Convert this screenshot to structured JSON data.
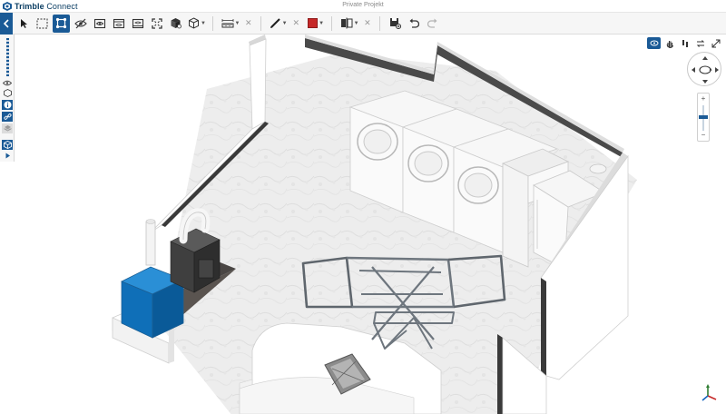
{
  "app": {
    "brand_name": "Trimble",
    "brand_product": "Connect",
    "project_title": "Private Projekt"
  },
  "colors": {
    "accent": "#1a5a96",
    "markup_color": "#c62828"
  },
  "toolbar": {
    "items": [
      {
        "icon": "back-arrow-icon"
      },
      {
        "icon": "select-pointer-icon"
      },
      {
        "icon": "box-select-icon"
      },
      {
        "icon": "node-select-icon",
        "active": true
      },
      {
        "icon": "hide-icon"
      },
      {
        "icon": "isolate-icon"
      },
      {
        "icon": "section-box-icon"
      },
      {
        "icon": "section-plane-icon"
      },
      {
        "icon": "fit-view-icon"
      },
      {
        "icon": "object-properties-icon"
      },
      {
        "icon": "view-cube-icon"
      },
      {
        "icon": "measure-icon"
      },
      {
        "icon": "markup-pen-icon"
      },
      {
        "icon": "color-picker-icon"
      },
      {
        "icon": "clip-plane-icon"
      },
      {
        "icon": "save-view-icon"
      },
      {
        "icon": "undo-icon"
      },
      {
        "icon": "redo-icon"
      }
    ]
  },
  "leftbar": {
    "items": [
      "eye-icon",
      "cube-outline-icon",
      "info-icon",
      "link-icon",
      "layers-icon",
      "model-icon",
      "play-icon"
    ]
  },
  "navigation": {
    "modes": [
      "orbit-icon",
      "pan-icon",
      "walk-icon",
      "swap-icon",
      "expand-icon"
    ],
    "zoom_in": "+",
    "zoom_out": "−",
    "zoom_level": 0.55
  }
}
